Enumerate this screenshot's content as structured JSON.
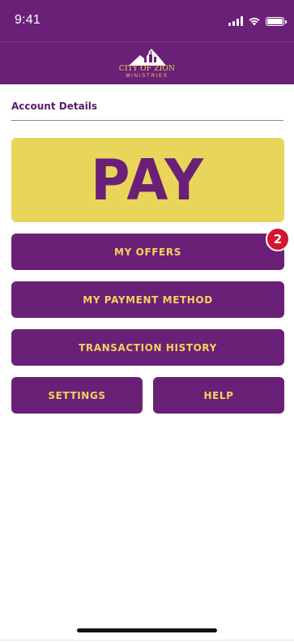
{
  "status_bar": {
    "time": "9:41",
    "icons": [
      "signal-icon",
      "wifi-icon",
      "battery-icon"
    ]
  },
  "header": {
    "logo_title": "CITY OF ZION",
    "logo_subtitle": "MINISTRIES"
  },
  "account": {
    "section_title": "Account Details"
  },
  "actions": {
    "pay_label": "PAY",
    "offers_label": "MY OFFERS",
    "offers_badge": "2",
    "payment_method_label": "MY PAYMENT METHOD",
    "transaction_history_label": "TRANSACTION HISTORY",
    "settings_label": "SETTINGS",
    "help_label": "HELP"
  },
  "colors": {
    "brand_purple": "#6a2077",
    "brand_gold": "#f1d55c",
    "pay_yellow": "#ead55b",
    "badge_red": "#d3172e"
  }
}
